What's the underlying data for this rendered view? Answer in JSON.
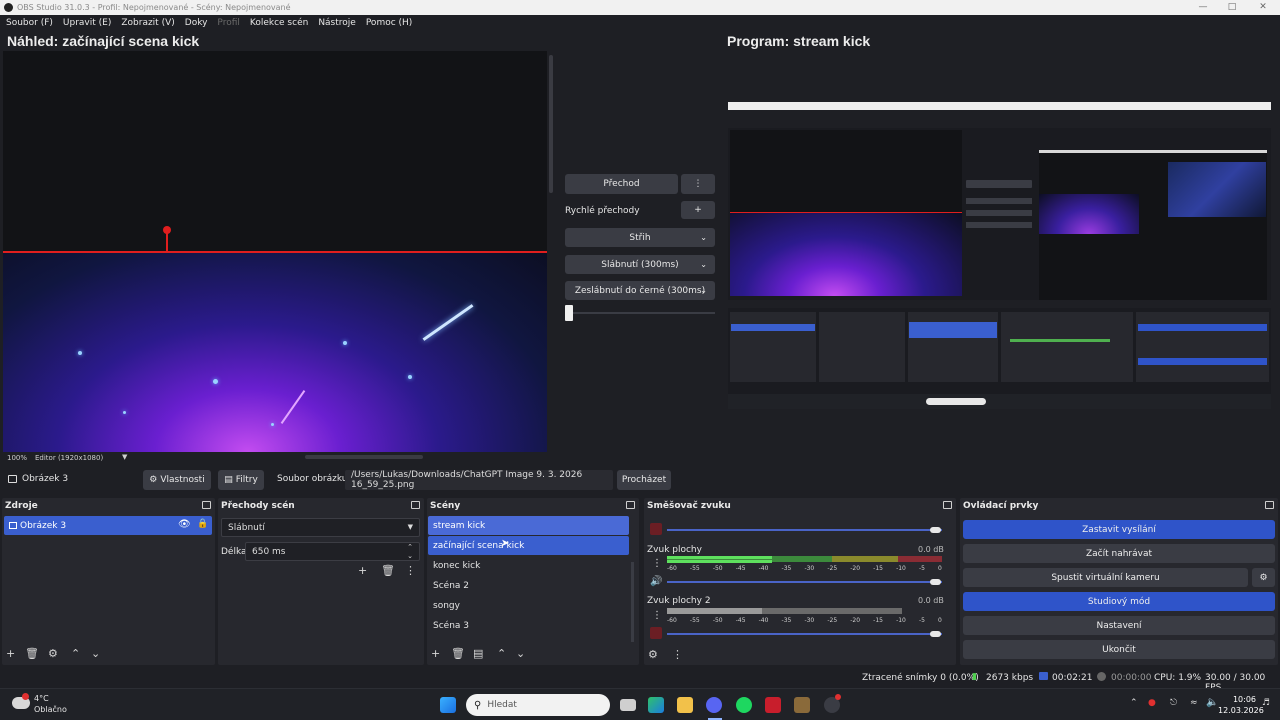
{
  "window": {
    "title": "OBS Studio 31.0.3 - Profil: Nepojmenované - Scény: Nepojmenované"
  },
  "menu": [
    "Soubor (F)",
    "Upravit (E)",
    "Zobrazit (V)",
    "Doky",
    "Profil",
    "Kolekce scén",
    "Nástroje",
    "Pomoc (H)"
  ],
  "preview": {
    "title": "Náhled: začínající scena kick",
    "zoom": "100%",
    "mode": "Editor (1920x1080)"
  },
  "program": {
    "title": "Program: stream kick"
  },
  "transitions_panel": {
    "transition_button": "Přechod",
    "quick_label": "Rychlé přechody",
    "quick_items": [
      "Střih",
      "Slábnutí (300ms)",
      "Zeslábnutí do černé (300ms)"
    ]
  },
  "source_toolbar": {
    "selected_source": "Obrázek 3",
    "properties": "Vlastnosti",
    "filters": "Filtry",
    "file_label": "Soubor obrázku",
    "file_path": "/Users/Lukas/Downloads/ChatGPT Image 9. 3. 2026 16_59_25.png",
    "browse": "Procházet"
  },
  "docks": {
    "sources": {
      "title": "Zdroje",
      "items": [
        "Obrázek 3"
      ]
    },
    "transitions": {
      "title": "Přechody scén",
      "selected": "Slábnutí",
      "duration_label": "Délka",
      "duration_value": "650 ms"
    },
    "scenes": {
      "title": "Scény",
      "items": [
        "stream kick",
        "začínající scena kick",
        "konec kick",
        "Scéna 2",
        "songy",
        "Scéna 3"
      ]
    },
    "mixer": {
      "title": "Směšovač zvuku",
      "channels": [
        {
          "name": "",
          "db": ""
        },
        {
          "name": "Zvuk plochy",
          "db": "0.0 dB"
        },
        {
          "name": "Zvuk plochy 2",
          "db": "0.0 dB"
        }
      ],
      "ticks": [
        "-60",
        "-55",
        "-50",
        "-45",
        "-40",
        "-35",
        "-30",
        "-25",
        "-20",
        "-15",
        "-10",
        "-5",
        "0"
      ]
    },
    "controls": {
      "title": "Ovládací prvky",
      "buttons": [
        "Zastavit vysílání",
        "Začít nahrávat",
        "Spustit virtuální kameru",
        "Studiový mód",
        "Nastavení",
        "Ukončit"
      ]
    }
  },
  "status": {
    "dropped": "Ztracené snímky 0 (0.0%)",
    "bitrate": "2673 kbps",
    "stream_time": "00:02:21",
    "rec_time": "00:00:00",
    "cpu": "CPU: 1.9%",
    "fps": "30.00 / 30.00 FPS"
  },
  "taskbar": {
    "weather_temp": "4°C",
    "weather_desc": "Oblačno",
    "search_placeholder": "Hledat",
    "time": "10:06",
    "date": "12.03.2026"
  },
  "colors": {
    "accent": "#3a5fcf",
    "background": "#1e1f24",
    "dock": "#27282e",
    "button": "#3a3c44"
  }
}
